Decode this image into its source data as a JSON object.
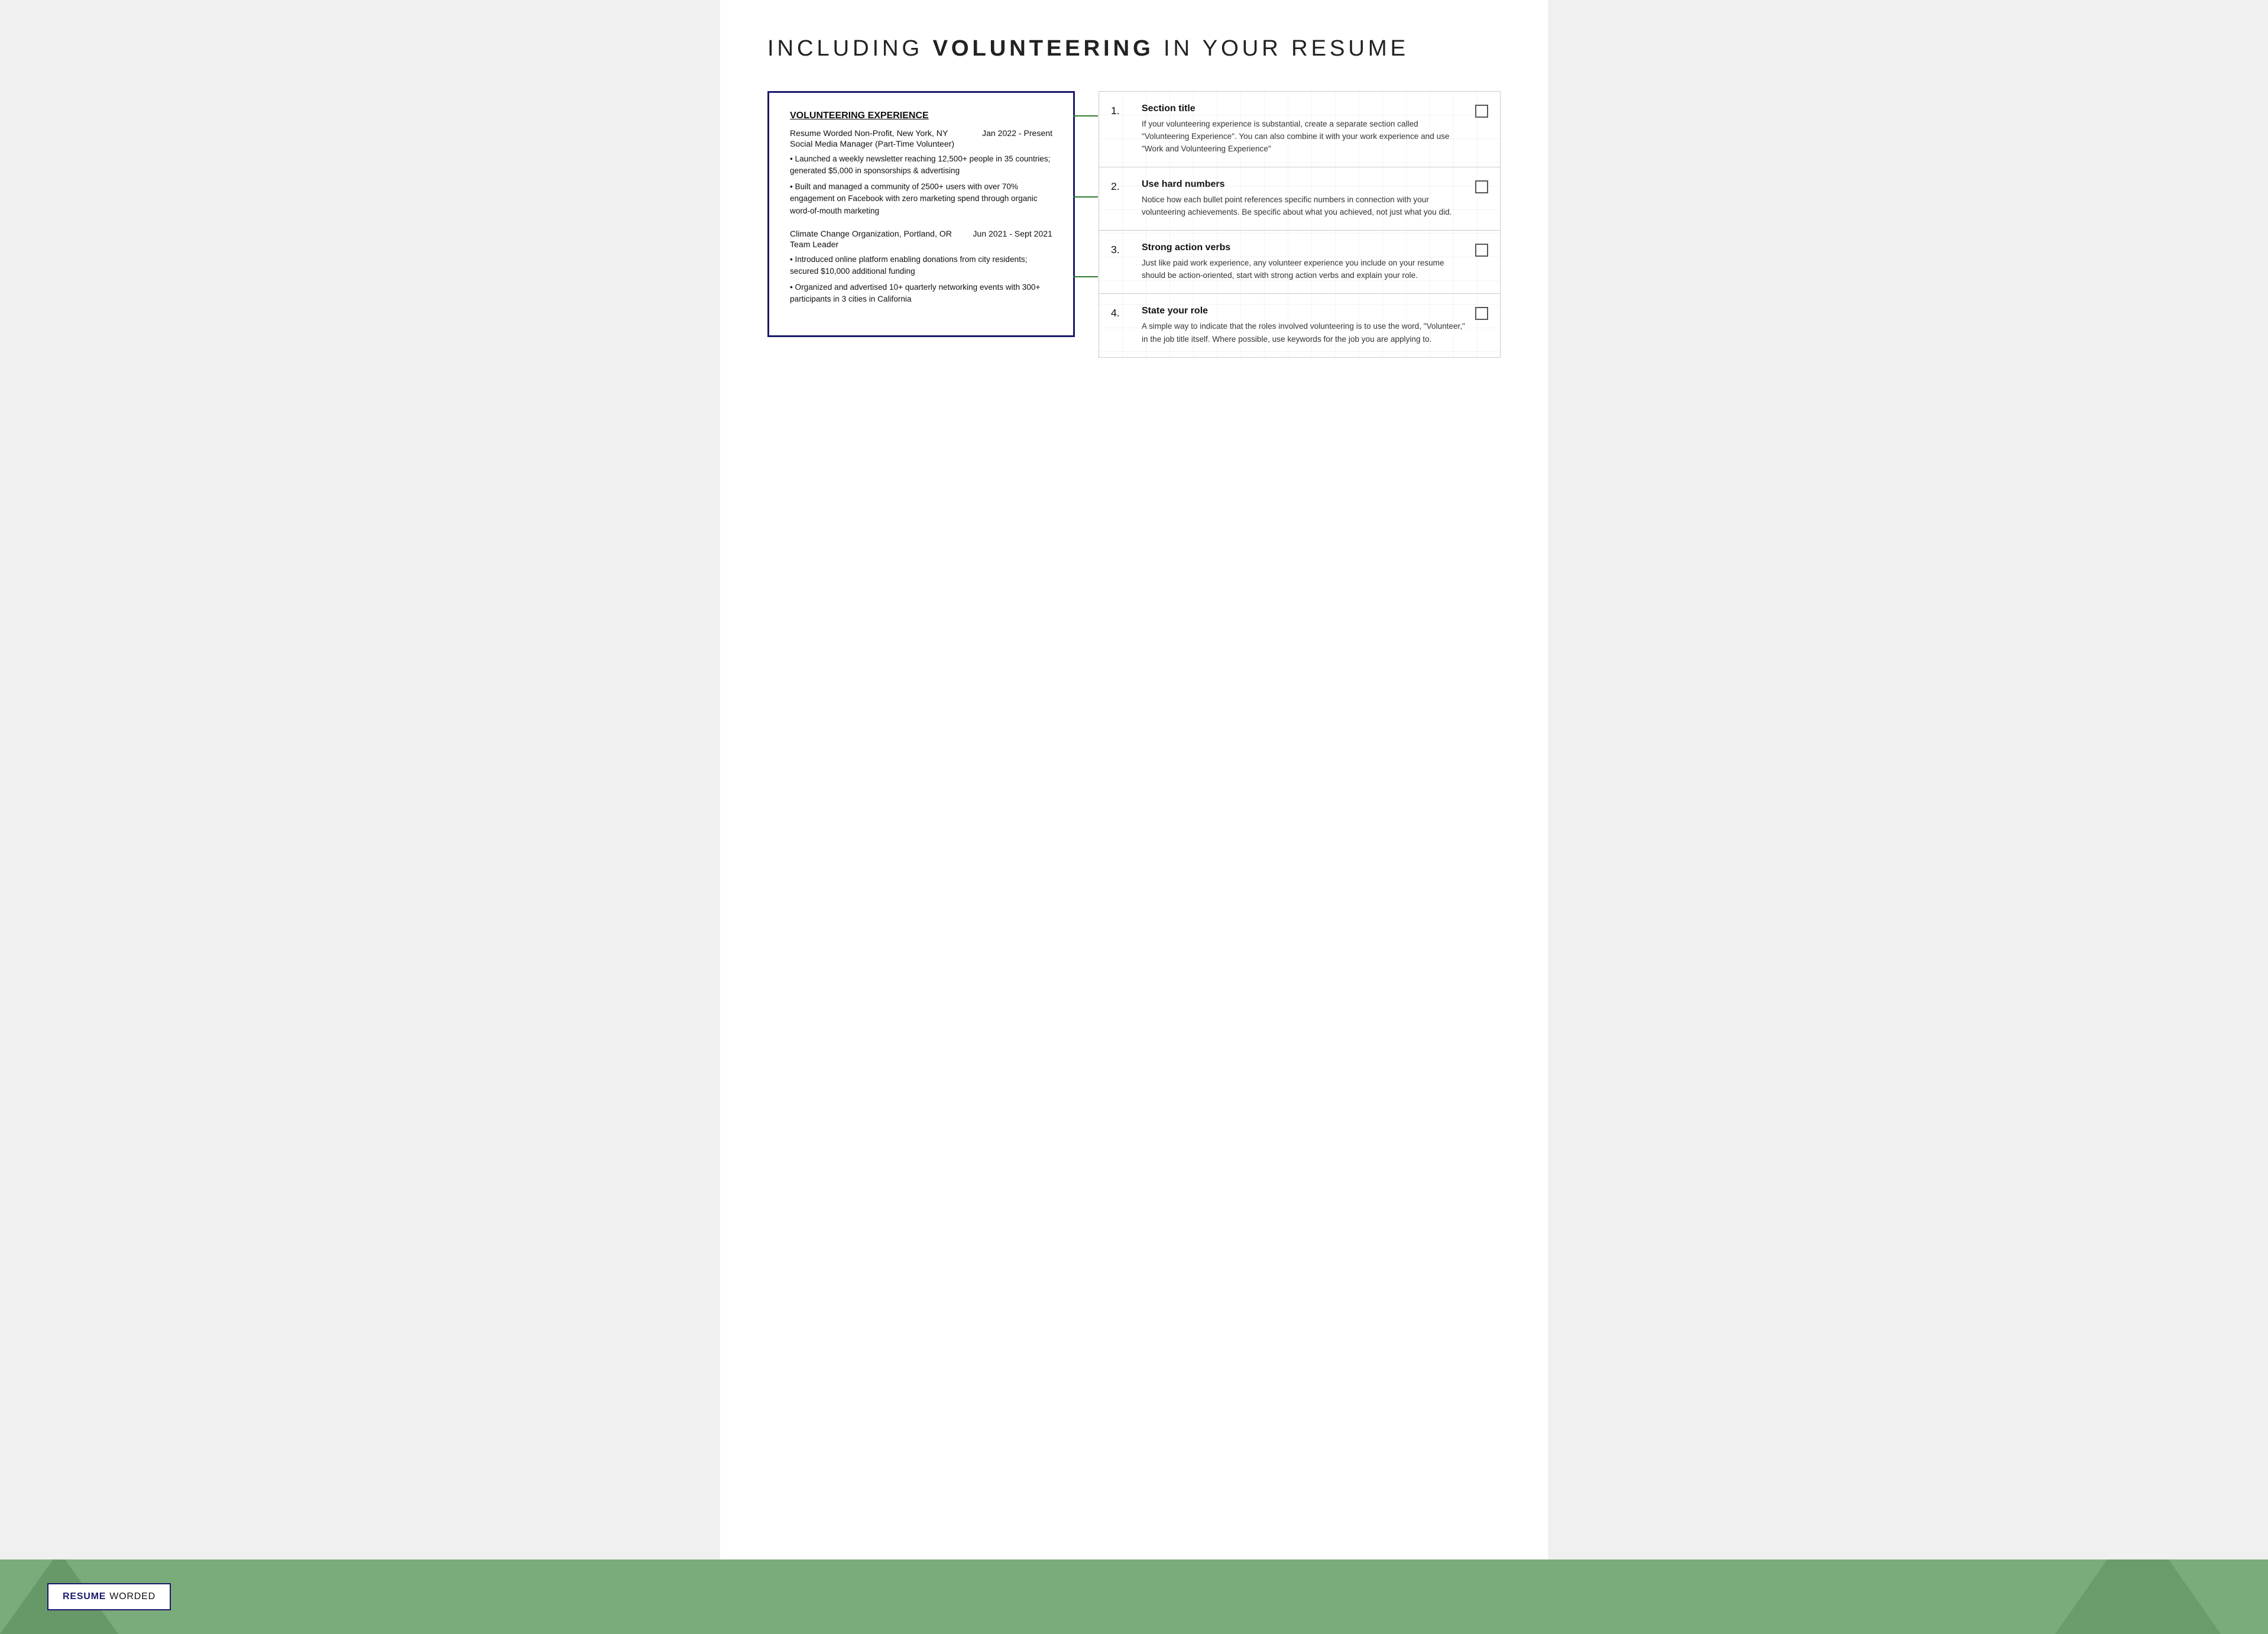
{
  "page": {
    "title_prefix": "INCLUDING ",
    "title_bold": "VOLUNTEERING",
    "title_suffix": " IN YOUR RESUME"
  },
  "resume": {
    "section_title": "VOLUNTEERING EXPERIENCE",
    "entries": [
      {
        "org": "Resume Worded Non-Profit, New York, NY",
        "date": "Jan 2022 - Present",
        "role": "Social Media Manager (Part-Time Volunteer)",
        "bullets": [
          "• Launched a weekly newsletter reaching 12,500+ people in 35 countries; generated $5,000 in sponsorships & advertising",
          "• Built and managed a community of 2500+ users with over 70% engagement on Facebook with zero marketing spend through organic word-of-mouth marketing"
        ]
      },
      {
        "org": "Climate Change Organization, Portland, OR",
        "date": "Jun 2021 - Sept 2021",
        "role": "Team Leader",
        "bullets": [
          "• Introduced online platform enabling donations from city residents; secured $10,000 additional funding",
          "• Organized and advertised 10+ quarterly networking events with 300+ participants in 3 cities in California"
        ]
      }
    ]
  },
  "tips": [
    {
      "number": "1.",
      "title": "Section title",
      "description": "If your volunteering experience is substantial, create a separate section called \"Volunteering Experience\". You can also combine it with your work experience and use \"Work and Volunteering Experience\""
    },
    {
      "number": "2.",
      "title": "Use hard numbers",
      "description": "Notice how each bullet point references specific numbers in connection with your volunteering achievements. Be specific about what you achieved, not just what you did."
    },
    {
      "number": "3.",
      "title": "Strong action verbs",
      "description": "Just like paid work experience, any volunteer experience you include on your resume should be action-oriented, start with strong action verbs and explain your role."
    },
    {
      "number": "4.",
      "title": "State your role",
      "description": "A simple way to indicate that the roles involved volunteering is to use the word, \"Volunteer,\" in the job title itself. Where possible, use keywords for the job you are applying to."
    }
  ],
  "brand": {
    "resume": "RESUME",
    "worded": "WORDED"
  }
}
